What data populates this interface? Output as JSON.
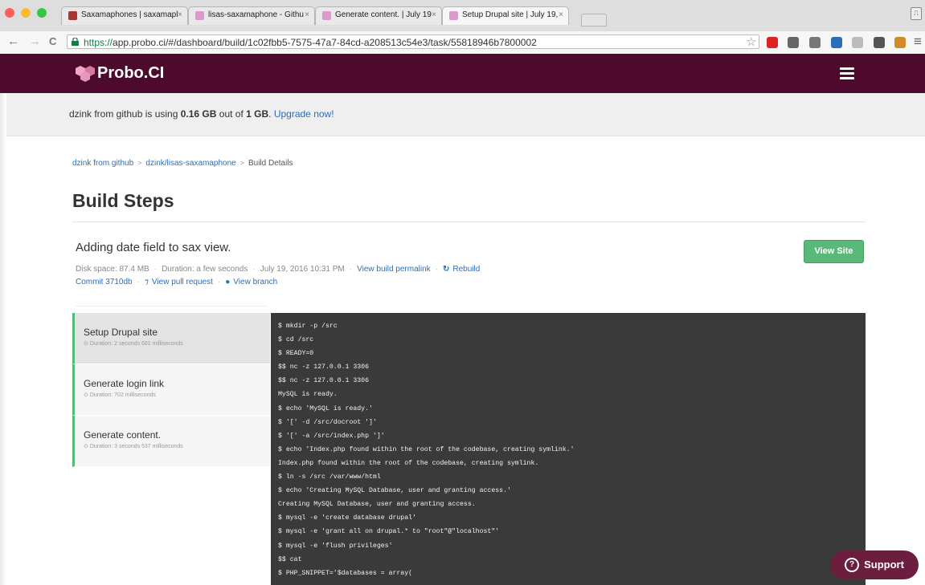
{
  "browser": {
    "tabs": [
      {
        "title": "Saxamaphones | saxamapl",
        "close": "×",
        "fav_color": "#a33"
      },
      {
        "title": "lisas-saxamaphone - Githu",
        "close": "×",
        "fav_color": "#d9c"
      },
      {
        "title": "Generate content. | July 19",
        "close": "×",
        "fav_color": "#d9c"
      },
      {
        "title": "Setup Drupal site | July 19,",
        "close": "×",
        "fav_color": "#d9c"
      }
    ],
    "url_scheme": "https://",
    "url_rest": "app.probo.ci/#/dashboard/build/1c02fbb5-7575-47a7-84cd-a208513c54e3/task/55818946b7800002",
    "nav": {
      "back": "←",
      "forward": "→",
      "reload": "C"
    },
    "star": "☆",
    "menu": "≡",
    "extensions": [
      "#d22",
      "#666",
      "#777",
      "#2a6ebb",
      "#bbb",
      "#555",
      "#d08a2a"
    ]
  },
  "app": {
    "logo_text": "Probo.CI",
    "brand_color": "#4d0a2c"
  },
  "usage": {
    "prefix": "dzink from github is using ",
    "used": "0.16 GB",
    "middle": " out of ",
    "total": "1 GB",
    "suffix": ". ",
    "upgrade_link": "Upgrade now!"
  },
  "breadcrumb": {
    "items": [
      "dzink from github",
      "dzink/lisas-saxamaphone",
      "Build Details"
    ],
    "separator": ">"
  },
  "page_title": "Build Steps",
  "build": {
    "name": "Adding date field to sax view.",
    "view_site": "View Site",
    "disk_space": "Disk space: 87.4 MB",
    "duration": "Duration: a few seconds",
    "date": "July 19, 2016 10:31 PM",
    "permalink": "View build permalink",
    "rebuild": "Rebuild",
    "commit": "Commit 3710db",
    "pull_request": "View pull request",
    "branch": "View branch"
  },
  "steps": [
    {
      "name": "Setup Drupal site",
      "duration": "Duration: 2 seconds 681 milliseconds",
      "active": true
    },
    {
      "name": "Generate login link",
      "duration": "Duration: 702 milliseconds",
      "active": false
    },
    {
      "name": "Generate content.",
      "duration": "Duration: 3 seconds 537 milliseconds",
      "active": false
    }
  ],
  "console_lines": [
    "$ mkdir -p /src",
    "$ cd /src",
    "$ READY=0",
    "$$ nc -z 127.0.0.1 3306",
    "$$ nc -z 127.0.0.1 3306",
    "MySQL is ready.",
    "$ echo 'MySQL is ready.'",
    "$ '[' -d /src/docroot ']'",
    "$ '[' -a /src/index.php ']'",
    "$ echo 'Index.php found within the root of the codebase, creating symlink.'",
    "Index.php found within the root of the codebase, creating symlink.",
    "$ ln -s /src /var/www/html",
    "$ echo 'Creating MySQL Database, user and granting access.'",
    "Creating MySQL Database, user and granting access.",
    "$ mysql -e 'create database drupal'",
    "$ mysql -e 'grant all on drupal.* to \"root\"@\"localhost\"'",
    "$ mysql -e 'flush privileges'",
    "$$ cat",
    "$ PHP_SNIPPET='$databases = array("
  ],
  "support": {
    "label": "Support",
    "icon": "?"
  }
}
